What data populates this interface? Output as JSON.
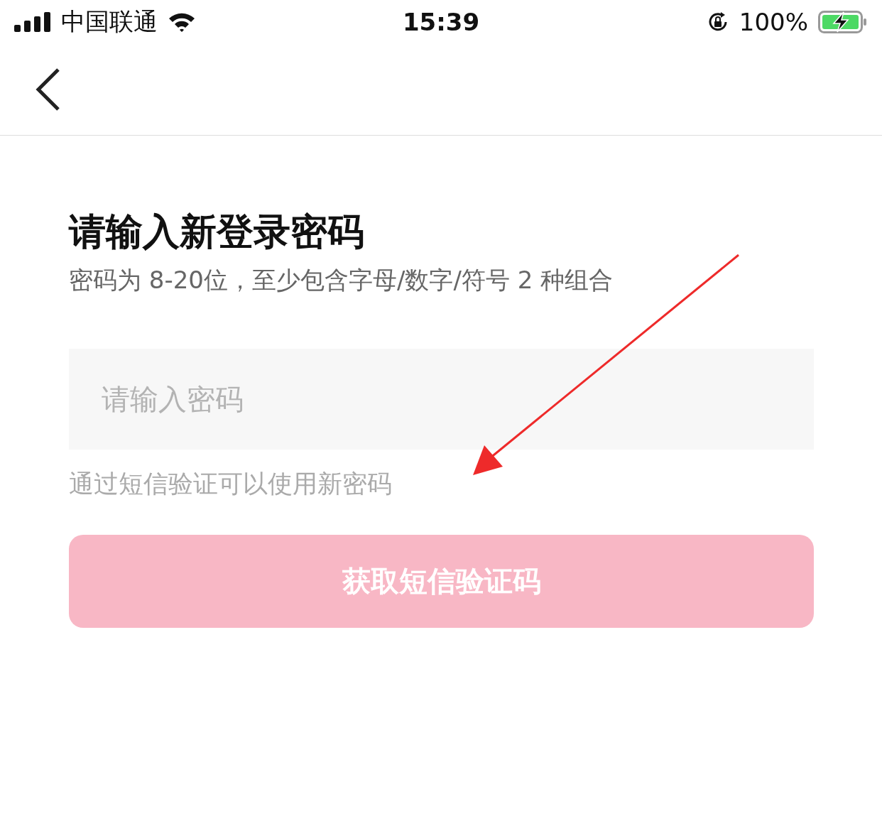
{
  "status_bar": {
    "carrier": "中国联通",
    "time": "15:39",
    "battery": "100%",
    "charging": true
  },
  "form": {
    "title": "请输入新登录密码",
    "subtitle": "密码为 8-20位，至少包含字母/数字/符号 2 种组合",
    "password_field": {
      "placeholder": "请输入密码"
    },
    "hint": "通过短信验证可以使用新密码",
    "submit": {
      "label": "获取短信验证码",
      "disabled": true
    }
  }
}
